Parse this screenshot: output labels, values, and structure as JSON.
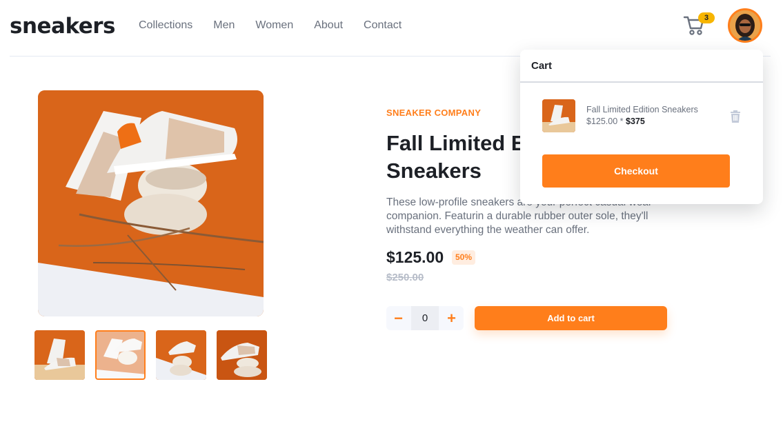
{
  "header": {
    "logo": "sneakers",
    "nav": [
      "Collections",
      "Men",
      "Women",
      "About",
      "Contact"
    ],
    "cart_count": "3",
    "avatar_alt": "user-avatar"
  },
  "product": {
    "company": "SNEAKER COMPANY",
    "title": "Fall Limited Edition Sneakers",
    "title_visible_line1": "Fall Limited E",
    "title_visible_line2": "Sneakers",
    "description": "These low-profile sneakers are your perfect casual wear companion. Featurin a durable rubber outer sole, they'll withstand everything the weather can offer.",
    "price": "$125.00",
    "discount": "50%",
    "old_price": "$250.00",
    "quantity": "0",
    "minus": "−",
    "plus": "+",
    "add_to_cart": "Add to cart",
    "thumbnail_count": 4,
    "active_thumbnail_index": 1
  },
  "cart": {
    "title": "Cart",
    "item_name": "Fall Limited Edition Sneakers",
    "item_unit_price": "$125.00 * ",
    "item_total": "$375",
    "checkout": "Checkout"
  },
  "colors": {
    "accent": "#ff7e1b",
    "accent_light": "#ffede0",
    "badge": "#f7b500",
    "text_dark": "#1d2026",
    "text_gray": "#69707d",
    "text_light": "#b6bcc8"
  },
  "icons": {
    "cart": "cart-icon",
    "trash": "trash-icon",
    "minus": "minus-icon",
    "plus": "plus-icon"
  }
}
